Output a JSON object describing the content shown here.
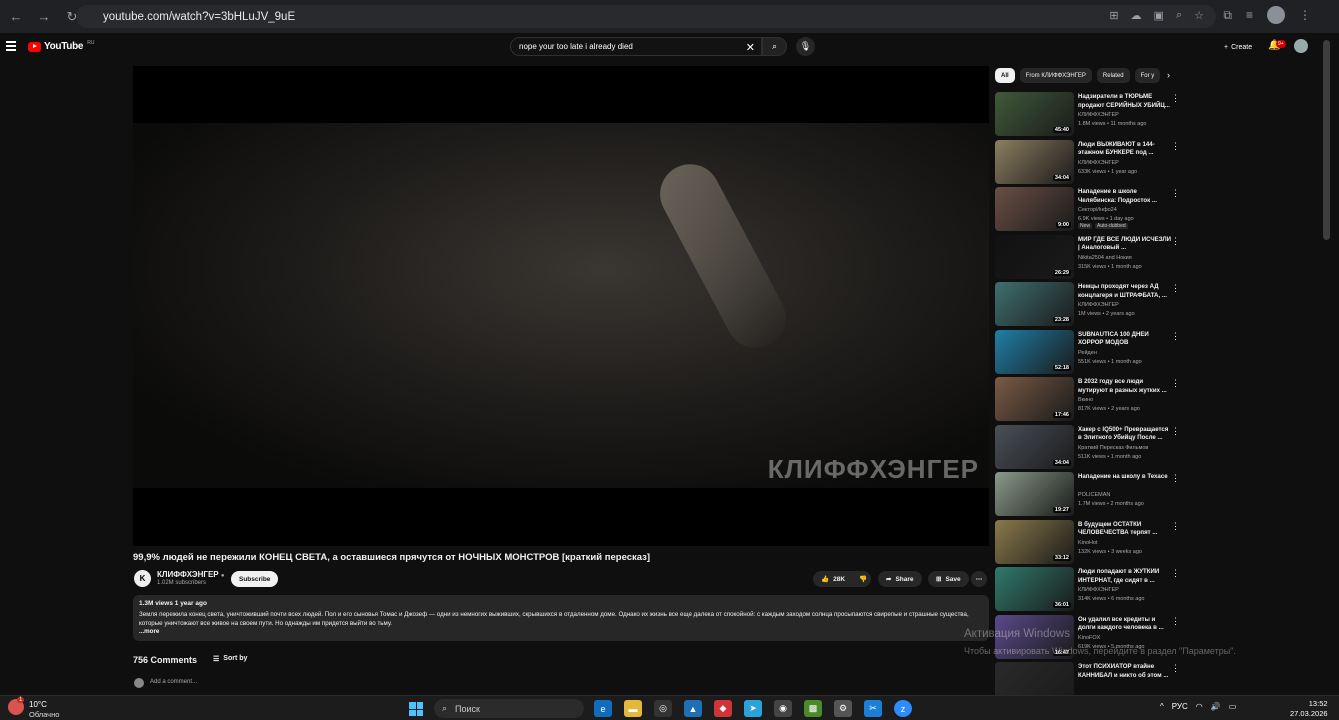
{
  "browser": {
    "url": "youtube.com/watch?v=3bHLuJV_9uE"
  },
  "header": {
    "logo_text": "YouTube",
    "region": "RU",
    "search_value": "nope your too late i already died",
    "create_label": "Create",
    "notification_count": "9+"
  },
  "video": {
    "watermark": "КЛИФФХЭНГЕР",
    "title": "99,9% людей не пережили КОНЕЦ СВЕТА, а оставшиеся прячутся от НОЧНЫХ МОНСТРОВ [краткий пересказ]",
    "channel": "КЛИФФХЭНГЕР",
    "subscribers": "1.02M subscribers",
    "subscribe_label": "Subscribe",
    "likes": "28K",
    "share_label": "Share",
    "save_label": "Save"
  },
  "description": {
    "meta": "1.3M views  1 year ago",
    "text": "Земля пережила конец света, уничтоживший почти всех людей. Пол и его сыновья Томас и Джозеф — одни из немногих выживших, скрывшихся в отдаленном доме. Однако их жизнь все еще далека от спокойной: с каждым заходом солнца просыпаются свирепые и страшные существа, которые уничтожают все живое на своем пути. Но однажды им придется выйти во тьму.",
    "more": "...more"
  },
  "comments": {
    "count": "756 Comments",
    "sort_label": "Sort by",
    "add_placeholder": "Add a comment..."
  },
  "chips": [
    "All",
    "From КЛИФФХЭНГЕР",
    "Related",
    "For y"
  ],
  "recommendations": [
    {
      "title": "Надзиратели в ТЮРЬМЕ продают СЕРИЙНЫХ УБИЙЦ...",
      "channel": "КЛИФФХЭНГЕР",
      "meta": "1.8M views • 11 months ago",
      "duration": "45:40",
      "color": "#3f5a3a"
    },
    {
      "title": "Люди ВЫЖИВАЮТ в 144-этажном БУНКЕРЕ под ...",
      "channel": "КЛИФФХЭНГЕР",
      "meta": "633K views • 1 year ago",
      "duration": "34:04",
      "color": "#8c7e60"
    },
    {
      "title": "Нападение в школе Челябинска: Подросток ...",
      "channel": "СекторИнфо24",
      "meta": "6.9K views • 1 day ago",
      "duration": "9:00",
      "color": "#6a4f44",
      "badges": [
        "New",
        "Auto-dubbed"
      ]
    },
    {
      "title": "МИР ГДЕ ВСЕ ЛЮДИ ИСЧЕЗЛИ | Аналоговый ...",
      "channel": "Nikita2504  and Нокия",
      "meta": "315K views • 1 month ago",
      "duration": "26:29",
      "color": "#111111"
    },
    {
      "title": "Немцы проходят через АД концлагеря и ШТРАФБАТА, ...",
      "channel": "КЛИФФХЭНГЕР",
      "meta": "1M views • 2 years ago",
      "duration": "23:28",
      "color": "#3f6f6f"
    },
    {
      "title": "SUBNAUTICA 100 ДНЕЙ ХОРРОР МОДОВ",
      "channel": "Рейден",
      "meta": "551K views • 1 month ago",
      "duration": "52:18",
      "color": "#1f7fa8"
    },
    {
      "title": "В 2032 году все люди мутируют в разных жутких ...",
      "channel": "Вкино",
      "meta": "817K views • 2 years ago",
      "duration": "17:46",
      "color": "#7a5a45"
    },
    {
      "title": "Хакер с IQ500+ Превращается в Элитного Убийцу После ...",
      "channel": "Краткий Пересказ Фильмов",
      "meta": "511K views • 1 month ago",
      "duration": "34:04",
      "color": "#4a5058"
    },
    {
      "title": "Нападение на школу в Техасе",
      "channel": "POLICEMAN",
      "meta": "1.7M views • 2 months ago",
      "duration": "19:27",
      "color": "#8a9a8a"
    },
    {
      "title": "В будущем ОСТАТКИ ЧЕЛОВЕЧЕСТВА терпят ...",
      "channel": "KinoHot",
      "meta": "132K views • 3 weeks ago",
      "duration": "33:12",
      "color": "#8a7a4a"
    },
    {
      "title": "Люди попадают в ЖУТКИЙ ИНТЕРНАТ, где сидят в ...",
      "channel": "КЛИФФХЭНГЕР",
      "meta": "314K views • 6 months ago",
      "duration": "36:01",
      "color": "#2f7a6a"
    },
    {
      "title": "Он удалил все кредиты и долги каждого человека в ...",
      "channel": "KinoFOX",
      "meta": "619K views • 5 months ago",
      "duration": "16:47",
      "color": "#5a4a8a"
    },
    {
      "title": "Этот ПСИХИАТОР втайне КАННИБАЛ и никто об этом ...",
      "channel": "",
      "meta": "",
      "duration": "",
      "color": "#2a2a2a"
    }
  ],
  "windows_notice": {
    "line1": "Активация Windows",
    "line2": "Чтобы активировать Windows, перейдите в раздел \"Параметры\"."
  },
  "taskbar": {
    "weather_temp": "10°C",
    "weather_desc": "Облачно",
    "weather_badge": "1",
    "search_label": "Поиск",
    "lang": "РУС",
    "time": "13:52",
    "date": "27.03.2026"
  }
}
